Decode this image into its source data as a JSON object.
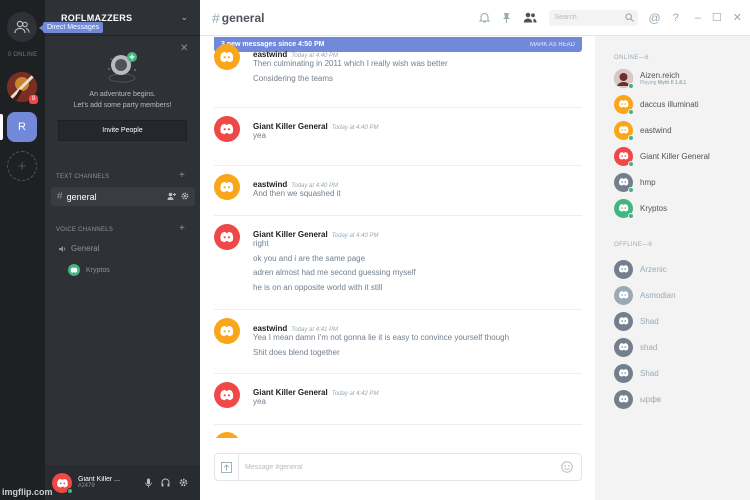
{
  "server_rail": {
    "dm_tooltip": "Direct Messages",
    "online_label": "0 ONLINE",
    "server_badge": "8",
    "selected_server_initial": "R",
    "add_server_symbol": "+"
  },
  "channels": {
    "guild_name": "ROFLMAZZERS",
    "invite": {
      "line1": "An adventure begins.",
      "line2": "Let's add some party members!",
      "button": "Invite People"
    },
    "text_category": "TEXT CHANNELS",
    "text_channels": [
      {
        "name": "general"
      }
    ],
    "voice_category": "VOICE CHANNELS",
    "voice_channels": [
      {
        "name": "General",
        "users": [
          "Kryptos"
        ]
      }
    ],
    "user_panel": {
      "name": "Giant Killer ...",
      "tag": "#2479"
    }
  },
  "header": {
    "channel_name": "general",
    "search_placeholder": "Search"
  },
  "chat": {
    "new_messages_bar": "3 new messages since 4:50 PM",
    "mark_as_read": "MARK AS READ",
    "messages": [
      {
        "user": "eastwind",
        "time": "Today at 4:40 PM",
        "avatar_color": "#faa61a",
        "lines": [
          "Then culminating in 2011 which I really wish was better",
          "Considering the teams"
        ]
      },
      {
        "user": "Giant Killer General",
        "time": "Today at 4:40 PM",
        "avatar_color": "#f04747",
        "lines": [
          "yea"
        ]
      },
      {
        "user": "eastwind",
        "time": "Today at 4:40 PM",
        "avatar_color": "#faa61a",
        "lines": [
          "And then we squashed it"
        ]
      },
      {
        "user": "Giant Killer General",
        "time": "Today at 4:40 PM",
        "avatar_color": "#f04747",
        "lines": [
          "right",
          "ok you and i are the same page",
          "adren almost had me second guessing myself",
          "he is on an opposite world with it still"
        ]
      },
      {
        "user": "eastwind",
        "time": "Today at 4:41 PM",
        "avatar_color": "#faa61a",
        "lines": [
          "Yea I mean damn I'm not gonna lie it is easy to convince yourself though",
          "Shit does blend together"
        ]
      },
      {
        "user": "Giant Killer General",
        "time": "Today at 4:42 PM",
        "avatar_color": "#f04747",
        "lines": [
          "yea"
        ]
      }
    ],
    "composer_placeholder": "Message #general"
  },
  "members": {
    "online_header": "ONLINE—6",
    "online": [
      {
        "name": "Aizen.reich",
        "activity_prefix": "Playing ",
        "activity_game": "Myth II 1.8.1",
        "avatar_color": "#a0524a",
        "status_color": "#43b581"
      },
      {
        "name": "daccus illuminati",
        "avatar_color": "#faa61a",
        "status_color": "#43b581"
      },
      {
        "name": "eastwind",
        "avatar_color": "#faa61a",
        "status_color": "#43b581"
      },
      {
        "name": "Giant Killer General",
        "avatar_color": "#f04747",
        "status_color": "#43b581"
      },
      {
        "name": "hmp",
        "avatar_color": "#747f8d",
        "status_color": "#43b581"
      },
      {
        "name": "Kryptos",
        "avatar_color": "#43b581",
        "status_color": "#43b581"
      }
    ],
    "offline_header": "OFFLINE—6",
    "offline": [
      {
        "name": "Arzenic",
        "avatar_color": "#747f8d"
      },
      {
        "name": "Asmodian",
        "avatar_color": "#99aab5"
      },
      {
        "name": "Shad",
        "avatar_color": "#747f8d"
      },
      {
        "name": "shad",
        "avatar_color": "#747f8d"
      },
      {
        "name": "Shad",
        "avatar_color": "#747f8d"
      },
      {
        "name": "ырфв",
        "avatar_color": "#747f8d"
      }
    ]
  },
  "watermark": "imgflip.com"
}
